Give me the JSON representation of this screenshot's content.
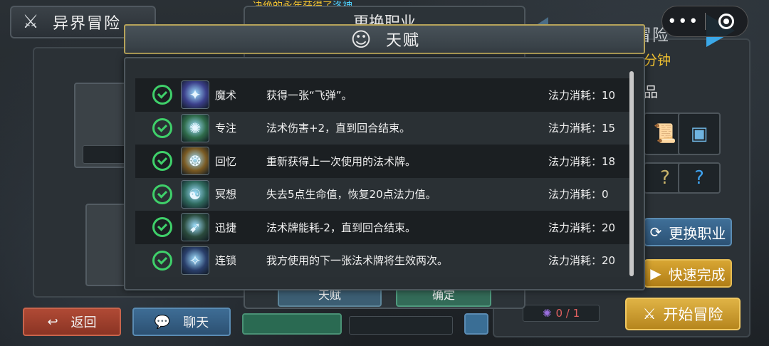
{
  "header": {
    "title": "异界冒险",
    "icon": "crossed-swords-icon"
  },
  "broadcast": {
    "prefix": "决绝的",
    "player": "永年",
    "middle": "获得了",
    "item": "洛神",
    "suffix": "。"
  },
  "back_dialog": {
    "title": "更换职业",
    "talent_button": "天赋",
    "confirm_button": "确定"
  },
  "right_panel": {
    "title": "初级异界冒险",
    "time": "分钟",
    "loot_label": "品",
    "change_job_button": "更换职业",
    "fast_complete_button": "快速完成",
    "start_button": "开始冒险",
    "counter": "0 / 1"
  },
  "bottom": {
    "back_button": "返回",
    "chat_button": "聊天"
  },
  "talent_modal": {
    "title": "天赋",
    "icon": "head-silhouette-icon",
    "talents": [
      {
        "name": "魔术",
        "desc": "获得一张“飞弹”。",
        "cost": "法力消耗：10",
        "icon_color": "#3b3f8a",
        "icon_glyph": "✦"
      },
      {
        "name": "专注",
        "desc": "法术伤害+2，直到回合结束。",
        "cost": "法力消耗：15",
        "icon_color": "#2f6b4a",
        "icon_glyph": "✺"
      },
      {
        "name": "回忆",
        "desc": "重新获得上一次使用的法术牌。",
        "cost": "法力消耗：18",
        "icon_color": "#7a5a22",
        "icon_glyph": "❂"
      },
      {
        "name": "冥想",
        "desc": "失去5点生命值，恢复20点法力值。",
        "cost": "法力消耗：0",
        "icon_color": "#2f6a5e",
        "icon_glyph": "☯"
      },
      {
        "name": "迅捷",
        "desc": "法术牌能耗-2，直到回合结束。",
        "cost": "法力消耗：20",
        "icon_color": "#2a4a3c",
        "icon_glyph": "➹"
      },
      {
        "name": "连锁",
        "desc": "我方使用的下一张法术牌将生效两次。",
        "cost": "法力消耗：20",
        "icon_color": "#2a3f6b",
        "icon_glyph": "✧"
      }
    ]
  }
}
